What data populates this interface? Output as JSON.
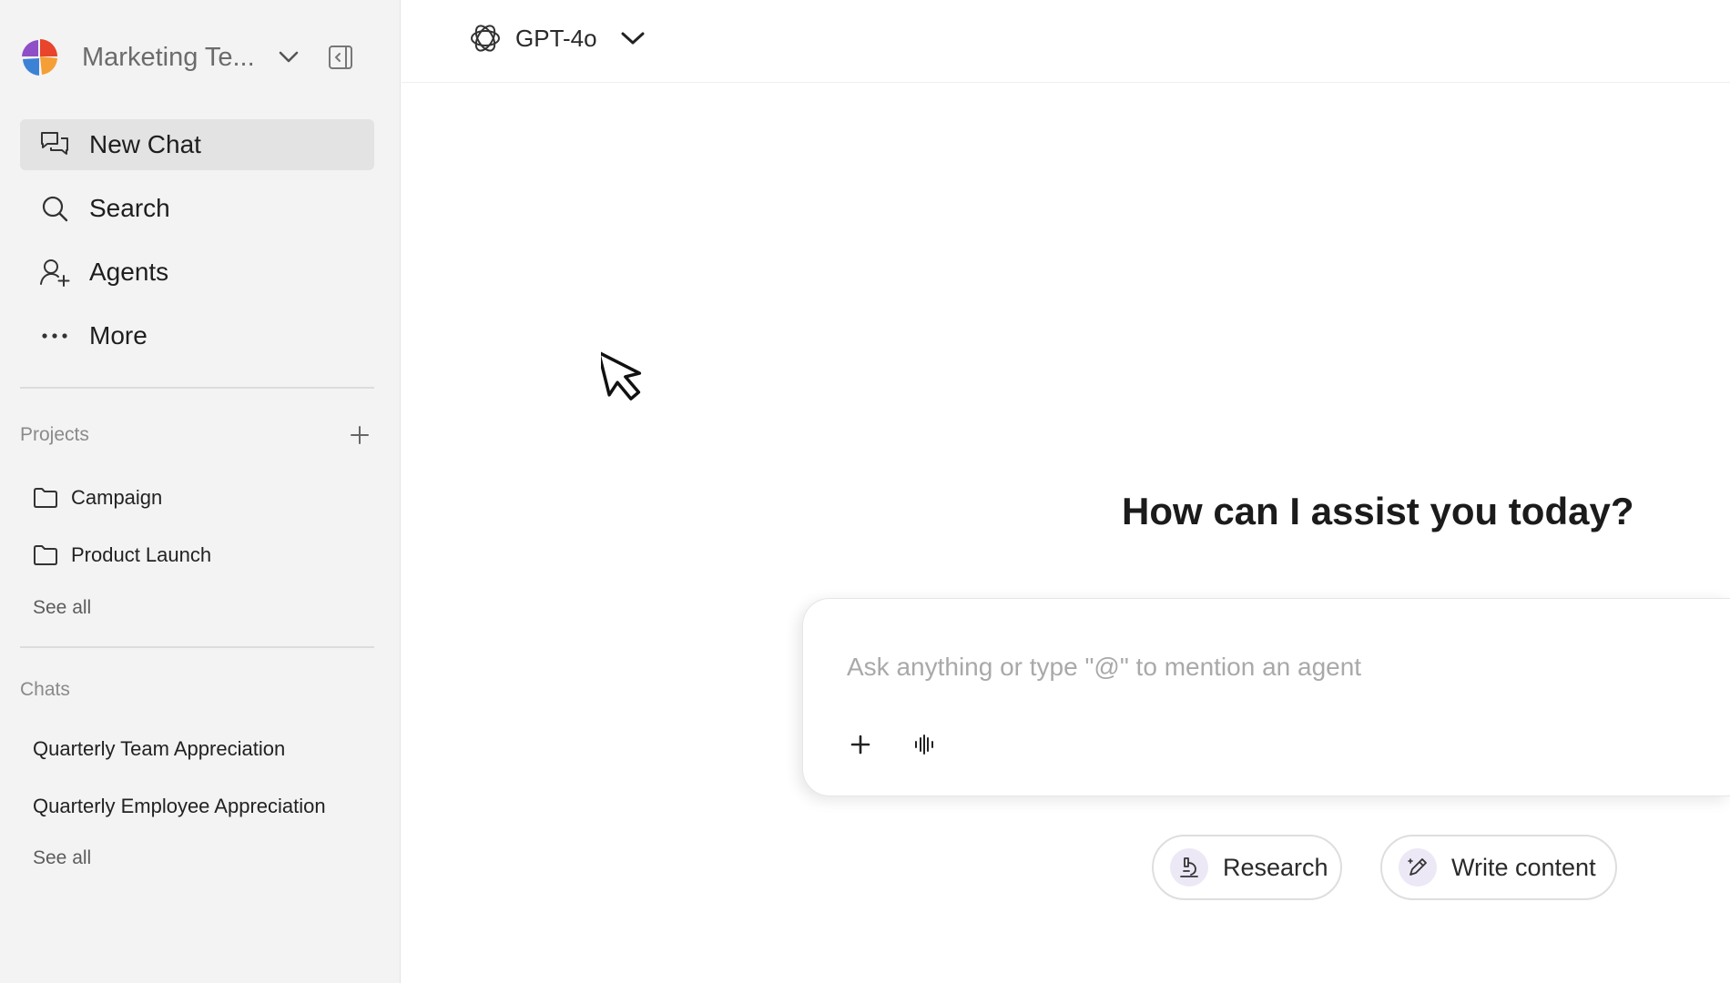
{
  "workspace": {
    "name": "Marketing Te...",
    "logo_icon": "workspace-logo",
    "menu_icon": "chevron-down-icon",
    "collapse_icon": "sidebar-collapse-icon"
  },
  "nav": {
    "new_chat": "New Chat",
    "search": "Search",
    "agents": "Agents",
    "more": "More"
  },
  "projects": {
    "title": "Projects",
    "items": [
      "Campaign",
      "Product Launch"
    ],
    "see_all": "See all"
  },
  "chats": {
    "title": "Chats",
    "items": [
      "Quarterly Team Appreciation",
      "Quarterly Employee Appreciation"
    ],
    "see_all": "See all"
  },
  "model": {
    "name": "GPT-4o"
  },
  "main": {
    "greeting": "How can I assist you today?",
    "input_placeholder": "Ask anything or type \"@\" to mention an agent",
    "input_value": ""
  },
  "suggestions": {
    "research": "Research",
    "write": "Write content"
  },
  "colors": {
    "sidebar_bg": "#f3f3f3",
    "active_item_bg": "#e3e3e3",
    "chip_icon_bg": "#ece8f6",
    "logo_red": "#e8452c",
    "logo_orange": "#f39a2b",
    "logo_blue": "#3b82d6",
    "logo_purple": "#8f4fc7"
  }
}
